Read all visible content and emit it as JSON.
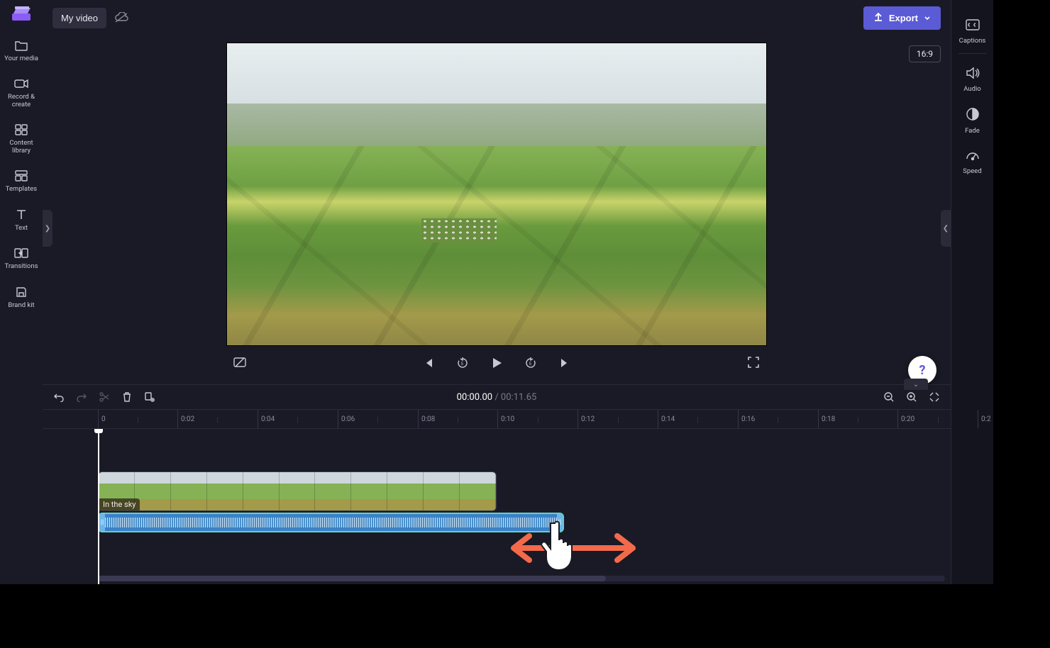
{
  "header": {
    "project_title": "My video",
    "export_label": "Export",
    "aspect_label": "16:9"
  },
  "left_nav": {
    "items": [
      {
        "id": "media",
        "label": "Your media"
      },
      {
        "id": "record",
        "label": "Record & create"
      },
      {
        "id": "library",
        "label": "Content library"
      },
      {
        "id": "templates",
        "label": "Templates"
      },
      {
        "id": "text",
        "label": "Text"
      },
      {
        "id": "transitions",
        "label": "Transitions"
      },
      {
        "id": "brand",
        "label": "Brand kit"
      }
    ]
  },
  "right_nav": {
    "items": [
      {
        "id": "captions",
        "label": "Captions"
      },
      {
        "id": "audio",
        "label": "Audio"
      },
      {
        "id": "fade",
        "label": "Fade"
      },
      {
        "id": "speed",
        "label": "Speed"
      }
    ]
  },
  "transport": {
    "current_time": "00:00.00",
    "duration": "00:11.65"
  },
  "ruler": {
    "start": 0,
    "ticks": [
      "0",
      "0:02",
      "0:04",
      "0:06",
      "0:08",
      "0:10",
      "0:12",
      "0:14",
      "0:16",
      "0:18",
      "0:20",
      "0:2"
    ]
  },
  "clips": {
    "video": {
      "label": "In the sky"
    },
    "audio": {
      "label": ""
    }
  },
  "help": {
    "label": "?"
  }
}
